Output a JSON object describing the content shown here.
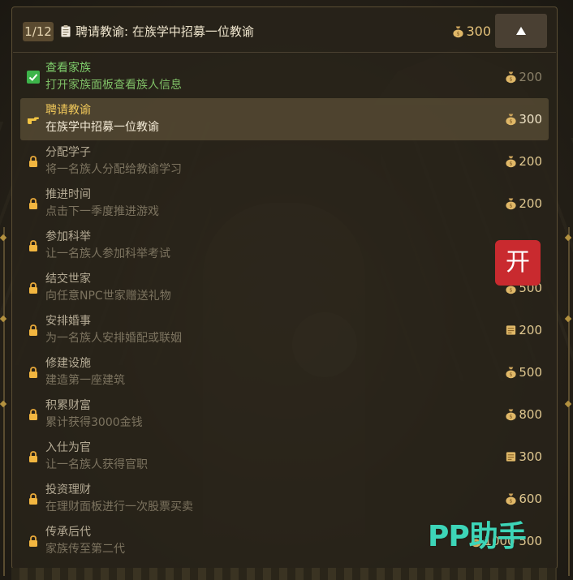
{
  "header": {
    "counter": "1/12",
    "task_icon": "clipboard-icon",
    "title": "聘请教谕: 在族学中招募一位教谕",
    "reward": "300",
    "reward_icon": "money-bag-icon",
    "collapse_icon": "triangle-up-icon"
  },
  "tasks": [
    {
      "state": "done",
      "state_icon": "checkmark-icon",
      "name": "查看家族",
      "desc": "打开家族面板查看族人信息",
      "reward": "200",
      "reward_icon": "money-bag-icon"
    },
    {
      "state": "current",
      "state_icon": "pointing-hand-icon",
      "name": "聘请教谕",
      "desc": "在族学中招募一位教谕",
      "reward": "300",
      "reward_icon": "money-bag-icon"
    },
    {
      "state": "locked",
      "state_icon": "lock-icon",
      "name": "分配学子",
      "desc": "将一名族人分配给教谕学习",
      "reward": "200",
      "reward_icon": "money-bag-icon"
    },
    {
      "state": "locked",
      "state_icon": "lock-icon",
      "name": "推进时间",
      "desc": "点击下一季度推进游戏",
      "reward": "200",
      "reward_icon": "money-bag-icon"
    },
    {
      "state": "locked",
      "state_icon": "lock-icon",
      "name": "参加科举",
      "desc": "让一名族人参加科举考试",
      "reward": "",
      "reward_icon": "money-bag-icon"
    },
    {
      "state": "locked",
      "state_icon": "lock-icon",
      "name": "结交世家",
      "desc": "向任意NPC世家赠送礼物",
      "reward": "500",
      "reward_icon": "money-bag-icon"
    },
    {
      "state": "locked",
      "state_icon": "lock-icon",
      "name": "安排婚事",
      "desc": "为一名族人安排婚配或联姻",
      "reward": "200",
      "reward_icon": "scroll-icon"
    },
    {
      "state": "locked",
      "state_icon": "lock-icon",
      "name": "修建设施",
      "desc": "建造第一座建筑",
      "reward": "500",
      "reward_icon": "money-bag-icon"
    },
    {
      "state": "locked",
      "state_icon": "lock-icon",
      "name": "积累财富",
      "desc": "累计获得3000金钱",
      "reward": "800",
      "reward_icon": "money-bag-icon"
    },
    {
      "state": "locked",
      "state_icon": "lock-icon",
      "name": "入仕为官",
      "desc": "让一名族人获得官职",
      "reward": "300",
      "reward_icon": "scroll-icon"
    },
    {
      "state": "locked",
      "state_icon": "lock-icon",
      "name": "投资理财",
      "desc": "在理财面板进行一次股票买卖",
      "reward": "600",
      "reward_icon": "money-bag-icon"
    },
    {
      "state": "locked",
      "state_icon": "lock-icon",
      "name": "传承后代",
      "desc": "家族传至第二代",
      "reward": "1000 500",
      "reward_icon": "money-bag-icon"
    }
  ],
  "overlay": {
    "open_button": "开",
    "watermark": "PP助手"
  }
}
